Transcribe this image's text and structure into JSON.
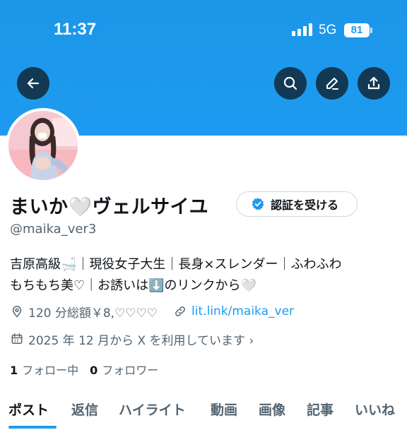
{
  "status_bar": {
    "time": "11:37",
    "network": "5G",
    "battery": "81"
  },
  "header": {
    "back_icon": "arrow-left-icon",
    "search_icon": "search-icon",
    "edit_icon": "pencil-icon",
    "share_icon": "share-icon",
    "banner_color": "#1d9bf0"
  },
  "profile": {
    "display_name": "まいか🤍ヴェルサイユ",
    "verify_label": "認証を受ける",
    "handle": "@maika_ver3",
    "bio_line1": "吉原高級🛁｜現役女子大生｜長身×スレンダー｜ふわふわ",
    "bio_line2": "もちもち美♡｜お誘いは⬇️のリンクから🤍",
    "location": "120 分総額￥8,♡♡♡♡",
    "link": "lit.link/maika_ver",
    "joined": "2025 年 12 月から X を利用しています ›",
    "following_count": "1",
    "following_label": "フォロー中",
    "followers_count": "0",
    "followers_label": "フォロワー"
  },
  "tabs": [
    "ポスト",
    "返信",
    "ハイライト",
    "動画",
    "画像",
    "記事",
    "いいね"
  ],
  "colors": {
    "accent": "#1d9bf0",
    "text": "#0f1419",
    "muted": "#536471"
  }
}
